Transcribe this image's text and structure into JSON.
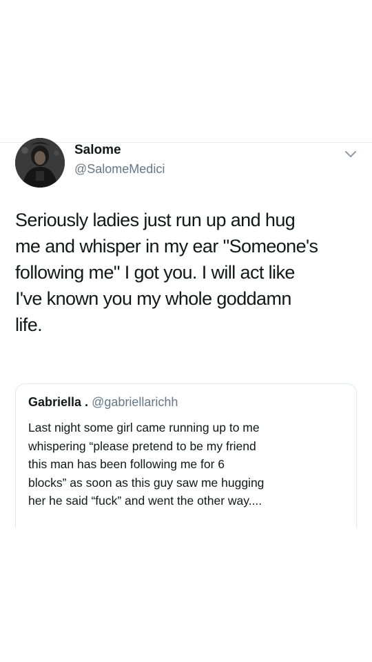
{
  "tweet": {
    "author": {
      "display_name": "Salome",
      "handle": "@SalomeMedici",
      "avatar_icon": "profile-photo"
    },
    "menu_icon": "chevron-down-icon",
    "text": "Seriously ladies just run up and hug\nme and whisper in my ear \"Someone's\nfollowing me\" I got you. I will act like\nI've known you my whole goddamn\nlife."
  },
  "quoted_tweet": {
    "display_name": "Gabriella .",
    "handle": "@gabriellarichh",
    "text": "Last night some girl came running up to me\nwhispering “please pretend to be my friend\nthis man has been following me for 6\nblocks” as soon as this guy saw me hugging\nher he said “fuck” and went the other way...."
  },
  "colors": {
    "text_primary": "#14171a",
    "text_secondary": "#657786",
    "border": "#e1e8ed"
  }
}
